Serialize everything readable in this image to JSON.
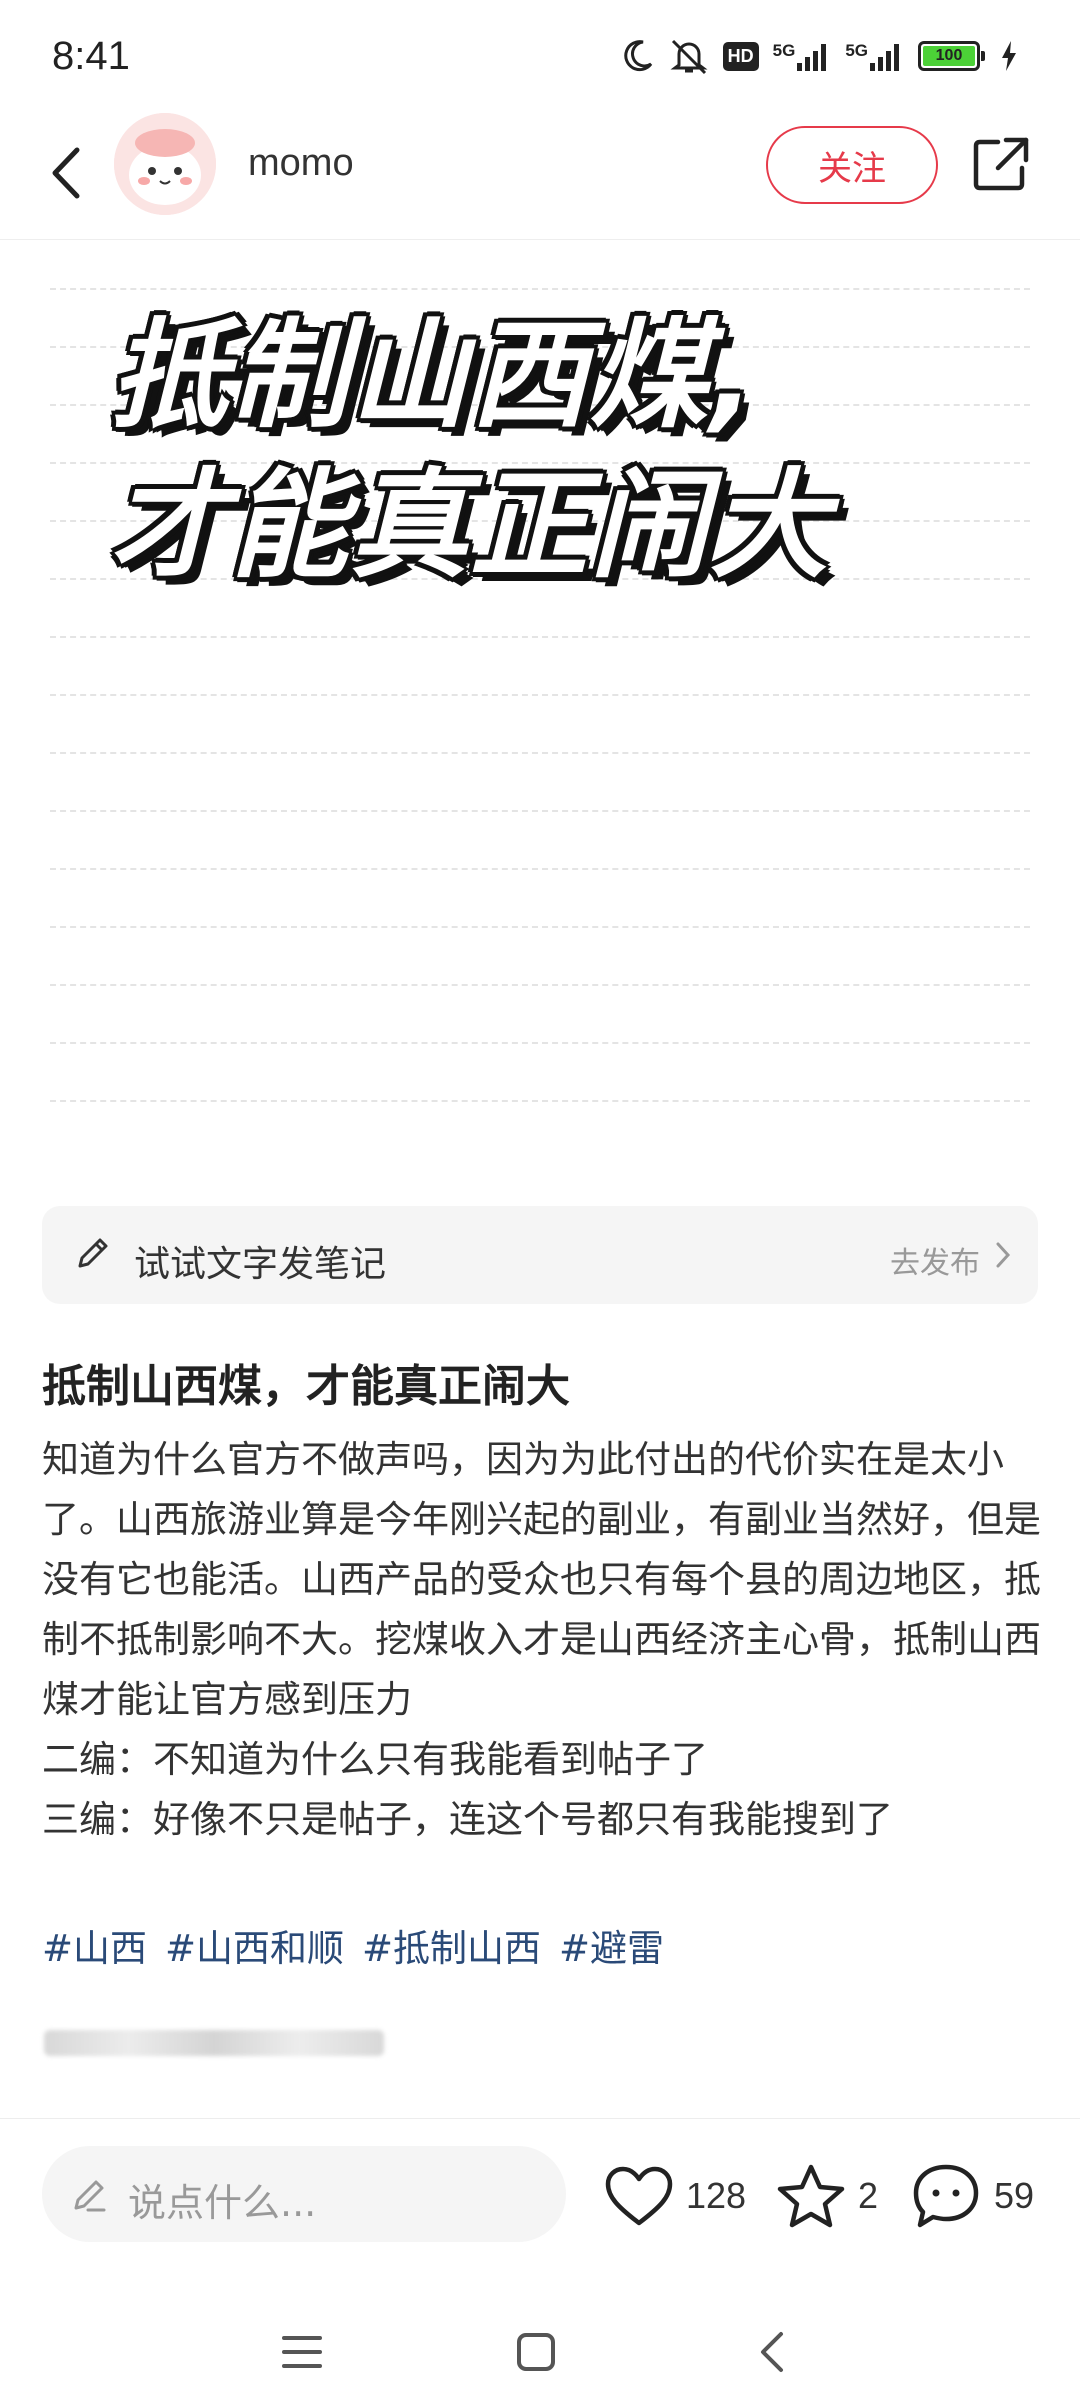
{
  "status_bar": {
    "time": "8:41",
    "hd_label": "HD",
    "network_1": "5G",
    "network_2": "5G",
    "battery": "100",
    "icons": [
      "moon-icon",
      "mute-bell-icon",
      "hd-icon",
      "signal-icon",
      "signal-icon",
      "battery-icon",
      "charging-icon"
    ]
  },
  "header": {
    "author_name": "momo",
    "follow_label": "关注",
    "icons": [
      "back-arrow-icon",
      "share-icon"
    ]
  },
  "cover": {
    "title_line_1": "抵制山西煤,",
    "title_line_2": "才能真正闹大"
  },
  "note_bar": {
    "label": "试试文字发笔记",
    "action": "去发布",
    "icons": [
      "pencil-icon",
      "chevron-right-icon"
    ]
  },
  "post": {
    "title": "抵制山西煤，才能真正闹大",
    "body": "知道为什么官方不做声吗，因为为此付出的代价实在是太小了。山西旅游业算是今年刚兴起的副业，有副业当然好，但是没有它也能活。山西产品的受众也只有每个县的周边地区，抵制不抵制影响不大。挖煤收入才是山西经济主心骨，抵制山西煤才能让官方感到压力",
    "edit_2": "二编：不知道为什么只有我能看到帖子了",
    "edit_3": "三编：好像不只是帖子，连这个号都只有我能搜到了",
    "tags": [
      "#山西",
      "#山西和顺",
      "#抵制山西",
      "#避雷"
    ]
  },
  "bottom_bar": {
    "comment_placeholder": "说点什么...",
    "likes": "128",
    "collects": "2",
    "comments": "59",
    "icons": [
      "edit-icon",
      "heart-icon",
      "star-icon",
      "comment-icon"
    ]
  },
  "nav_bar": {
    "icons": [
      "menu-icon",
      "home-square-icon",
      "back-chevron-icon"
    ]
  },
  "colors": {
    "accent": "#e63a4a",
    "tag": "#2a4a78",
    "battery": "#4cd137"
  }
}
